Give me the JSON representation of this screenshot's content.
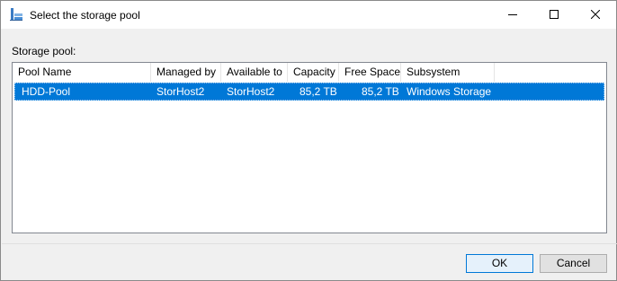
{
  "window": {
    "title": "Select the storage pool",
    "icon": "storage-pool-icon",
    "controls": [
      "minimize-icon",
      "maximize-icon",
      "close-icon"
    ]
  },
  "pool_label": "Storage pool:",
  "list": {
    "columns": [
      "Pool Name",
      "Managed by",
      "Available to",
      "Capacity",
      "Free Space",
      "Subsystem"
    ],
    "rows": [
      {
        "pool_name": "HDD-Pool",
        "managed_by": "StorHost2",
        "available_to": "StorHost2",
        "capacity": "85,2 TB",
        "free_space": "85,2 TB",
        "subsystem": "Windows Storage",
        "selected": true
      }
    ]
  },
  "buttons": {
    "ok": "OK",
    "cancel": "Cancel"
  },
  "colors": {
    "selection": "#0078d7",
    "default_button_border": "#0078d7"
  }
}
